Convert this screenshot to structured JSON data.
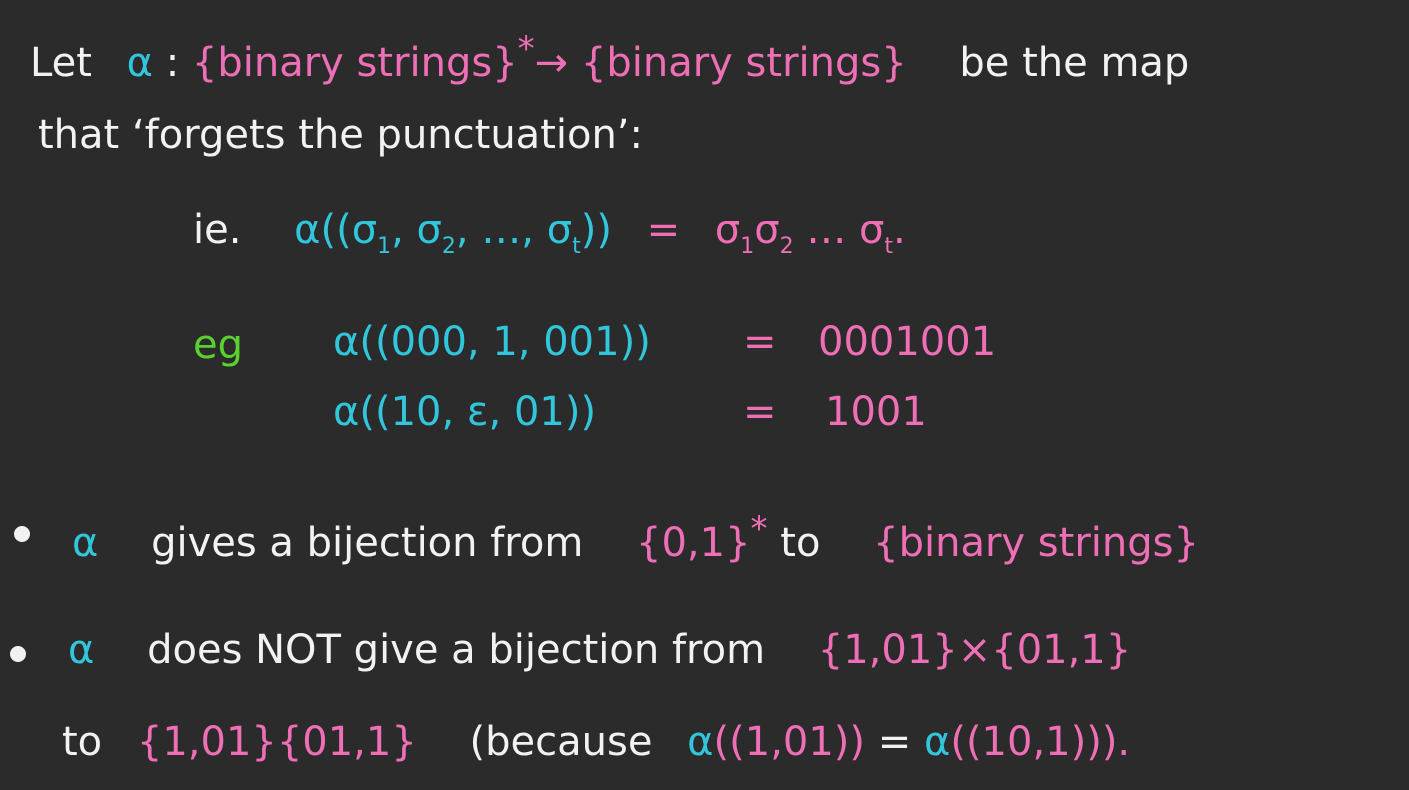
{
  "colors": {
    "background": "#2b2b2b",
    "text": "#f2f2f2",
    "pink": "#ee6fb5",
    "cyan": "#32c6dc",
    "green": "#59d12f"
  },
  "line1": {
    "let": "Let",
    "alpha": "α",
    "colon": ":",
    "domain": "{binary strings}",
    "star": "*",
    "arrow": "→",
    "codomain": "{binary strings}",
    "rest": "be the map"
  },
  "line2": {
    "text": "that ‘forgets the punctuation’:"
  },
  "ie": {
    "label": "ie.",
    "lhs_alpha": "α((σ",
    "s1": "1",
    "comma1": ", σ",
    "s2": "2",
    "ellipsis": ", …, σ",
    "st": "t",
    "close": "))",
    "eq": "=",
    "r1": "σ",
    "rs1": "1",
    "r2": "σ",
    "rs2": "2",
    "rdots": " … σ",
    "rst": "t",
    "period": "."
  },
  "eg": {
    "label": "eg",
    "ex1_lhs": "α((000, 1, 001))",
    "ex1_eq": "=",
    "ex1_rhs": "0001001",
    "ex2_lhs": "α((10, ε, 01))",
    "ex2_eq": "=",
    "ex2_rhs": "1001"
  },
  "bullet1": {
    "alpha": "α",
    "text1": "gives a bijection from",
    "set1": "{0,1}",
    "star": "*",
    "to": "to",
    "set2": "{binary strings}"
  },
  "bullet2": {
    "alpha": "α",
    "text1": "does NOT give a bijection from",
    "product": "{1,01}×{01,1}"
  },
  "line_last": {
    "to": "to",
    "concat": "{1,01}{01,1}",
    "because": "(because",
    "alpha1": "α",
    "arg1": "((1,01))",
    "eq": "=",
    "alpha2": "α",
    "arg2": "((10,1))).",
    "period": ""
  }
}
